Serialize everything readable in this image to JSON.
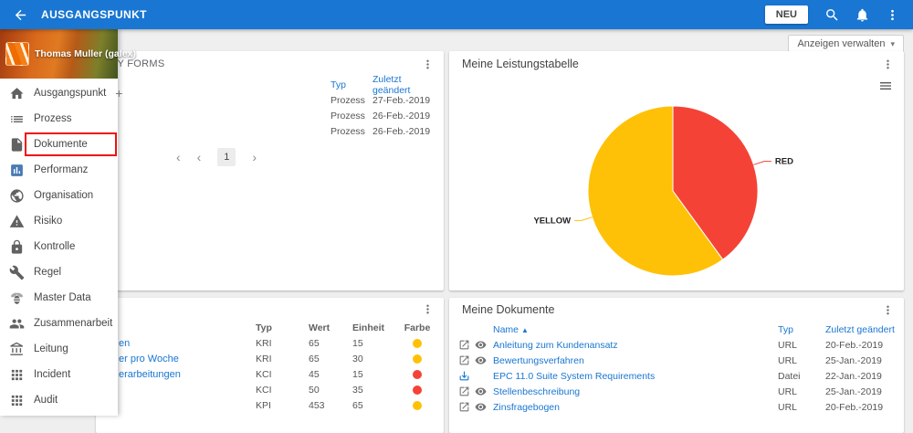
{
  "topbar": {
    "title": "AUSGANGSPUNKT",
    "neu_label": "NEU"
  },
  "toolbar": {
    "manage_views_label": "Anzeigen verwalten",
    "caret": "▾"
  },
  "sidebar": {
    "user_name": "Thomas Muller (galex)",
    "items": [
      {
        "key": "ausgangspunkt",
        "icon": "home",
        "label": "Ausgangspunkt",
        "trailing": "+"
      },
      {
        "key": "prozess",
        "icon": "list",
        "label": "Prozess"
      },
      {
        "key": "dokumente",
        "icon": "file",
        "label": "Dokumente",
        "highlighted": true
      },
      {
        "key": "performanz",
        "icon": "chart",
        "label": "Performanz",
        "icon_color": "#4a7ab5"
      },
      {
        "key": "organisation",
        "icon": "globe",
        "label": "Organisation"
      },
      {
        "key": "risiko",
        "icon": "warning",
        "label": "Risiko"
      },
      {
        "key": "kontrolle",
        "icon": "lock",
        "label": "Kontrolle"
      },
      {
        "key": "regel",
        "icon": "wrench",
        "label": "Regel"
      },
      {
        "key": "master-data",
        "icon": "bee",
        "label": "Master Data"
      },
      {
        "key": "zusammenarbeit",
        "icon": "people",
        "label": "Zusammenarbeit"
      },
      {
        "key": "leitung",
        "icon": "bank",
        "label": "Leitung"
      },
      {
        "key": "incident",
        "icon": "grid",
        "label": "Incident"
      },
      {
        "key": "audit",
        "icon": "grid",
        "label": "Audit"
      }
    ]
  },
  "forms_card": {
    "title": "MY FORMS",
    "columns": {
      "typ": "Typ",
      "date": "Zuletzt geändert"
    },
    "rows": [
      {
        "name": "",
        "typ": "Prozess",
        "date": "27-Feb.-2019"
      },
      {
        "name": "",
        "typ": "Prozess",
        "date": "26-Feb.-2019"
      },
      {
        "name": "",
        "typ": "Prozess",
        "date": "26-Feb.-2019"
      }
    ],
    "pagination": {
      "first": "‹",
      "prev": "‹",
      "page": "1",
      "next": "›"
    }
  },
  "performance_card": {
    "title": "Meine Leistungstabelle"
  },
  "chart_data": {
    "type": "pie",
    "title": "Meine Leistungstabelle",
    "label_position": "outside",
    "legend": false,
    "slices": [
      {
        "label": "RED",
        "value": 40,
        "color": "#f44336"
      },
      {
        "label": "YELLOW",
        "value": 60,
        "color": "#ffc107"
      }
    ]
  },
  "metrics_card": {
    "columns": {
      "typ": "Typ",
      "wert": "Wert",
      "einheit": "Einheit",
      "farbe": "Farbe"
    },
    "rows": [
      {
        "name": "en",
        "typ": "KRI",
        "wert": "65",
        "einheit": "15",
        "color": "#ffc107"
      },
      {
        "name": "er pro Woche",
        "typ": "KRI",
        "wert": "65",
        "einheit": "30",
        "color": "#ffc107"
      },
      {
        "name": "erarbeitungen",
        "typ": "KCI",
        "wert": "45",
        "einheit": "15",
        "color": "#f44336"
      },
      {
        "name": "",
        "typ": "KCI",
        "wert": "50",
        "einheit": "35",
        "color": "#f44336"
      },
      {
        "name": "",
        "typ": "KPI",
        "wert": "453",
        "einheit": "65",
        "color": "#ffc107"
      }
    ]
  },
  "documents_card": {
    "title": "Meine Dokumente",
    "columns": {
      "name": "Name",
      "sort_icon": "▲",
      "typ": "Typ",
      "date": "Zuletzt geändert"
    },
    "rows": [
      {
        "icons": [
          "open-in-new",
          "eye"
        ],
        "name": "Anleitung zum Kundenansatz",
        "typ": "URL",
        "date": "20-Feb.-2019"
      },
      {
        "icons": [
          "open-in-new",
          "eye"
        ],
        "name": "Bewertungsverfahren",
        "typ": "URL",
        "date": "25-Jan.-2019"
      },
      {
        "icons": [
          "download"
        ],
        "name": "EPC 11.0 Suite System Requirements",
        "typ": "Datei",
        "date": "22-Jan.-2019"
      },
      {
        "icons": [
          "open-in-new",
          "eye"
        ],
        "name": "Stellenbeschreibung",
        "typ": "URL",
        "date": "25-Jan.-2019"
      },
      {
        "icons": [
          "open-in-new",
          "eye"
        ],
        "name": "Zinsfragebogen",
        "typ": "URL",
        "date": "20-Feb.-2019"
      }
    ]
  },
  "colors": {
    "accent": "#1976d2",
    "red": "#f44336",
    "yellow": "#ffc107",
    "highlight_box": "#ee1111"
  }
}
